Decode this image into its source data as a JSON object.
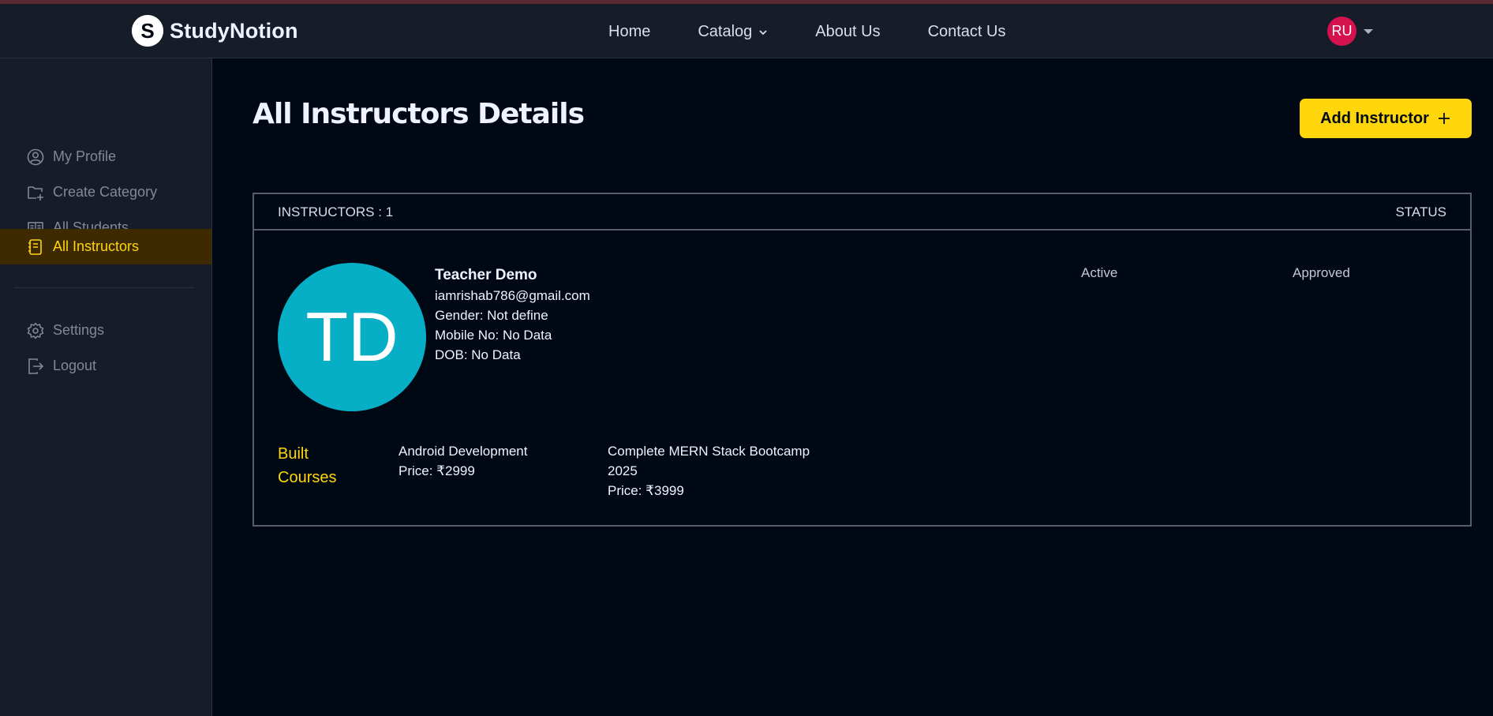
{
  "brand": {
    "name": "StudyNotion",
    "logo_letter": "S"
  },
  "nav": {
    "links": [
      "Home",
      "Catalog",
      "About Us",
      "Contact Us"
    ],
    "user_initials": "RU"
  },
  "sidebar": {
    "items": [
      {
        "label": "My Profile",
        "icon": "user-circle-icon"
      },
      {
        "label": "Create Category",
        "icon": "folder-plus-icon"
      },
      {
        "label": "All Students",
        "icon": "book-open-icon"
      },
      {
        "label": "All Instructors",
        "icon": "notebook-icon",
        "active": true
      }
    ],
    "bottom_items": [
      {
        "label": "Settings",
        "icon": "gear-icon"
      },
      {
        "label": "Logout",
        "icon": "logout-icon"
      }
    ]
  },
  "page": {
    "title": "All Instructors Details",
    "add_button_label": "Add Instructor"
  },
  "table": {
    "count_label": "INSTRUCTORS : 1",
    "status_header": "STATUS",
    "instructors": [
      {
        "initials": "TD",
        "name": "Teacher Demo",
        "email": "iamrishab786@gmail.com",
        "gender": "Gender: Not define",
        "mobile": "Mobile No: No Data",
        "dob": "DOB: No Data",
        "status_active": "Active",
        "status_approved": "Approved",
        "built_courses_label": [
          "Built",
          "Courses"
        ],
        "courses": [
          {
            "name": "Android Development",
            "price": "Price: ₹2999"
          },
          {
            "name": "Complete MERN Stack Bootcamp 2025",
            "price": "Price: ₹3999"
          }
        ]
      }
    ]
  },
  "colors": {
    "background": "#000814",
    "panel": "#161D29",
    "accent": "#FFD60A",
    "avatar_big": "#06AEC6",
    "avatar_small": "#D6124E",
    "active_sidebar_bg": "#3D2A01"
  }
}
